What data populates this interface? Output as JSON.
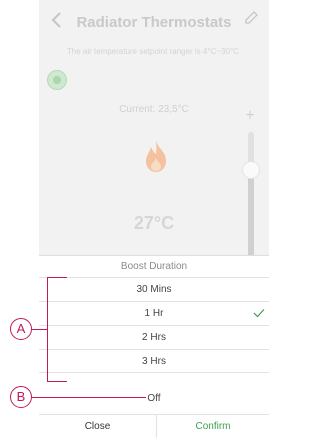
{
  "app": {
    "title": "Radiator Thermostats",
    "info_text": "The air temperature setpoint ranger is 4°C~30°C.",
    "current_label": "Current: 23,5°C",
    "setpoint": "27°C",
    "plus_symbol": "+"
  },
  "sheet": {
    "title": "Boost Duration",
    "options": [
      {
        "label": "30 Mins"
      },
      {
        "label": "1 Hr"
      },
      {
        "label": "2 Hrs"
      },
      {
        "label": "3 Hrs"
      }
    ],
    "off_label": "Off",
    "close_label": "Close",
    "confirm_label": "Confirm"
  },
  "annotations": {
    "a_label": "A",
    "b_label": "B"
  },
  "colors": {
    "accent": "#3aa14c",
    "annotation": "#c2185b"
  },
  "icons": [
    "back-icon",
    "edit-icon",
    "flame-icon",
    "check-icon"
  ]
}
